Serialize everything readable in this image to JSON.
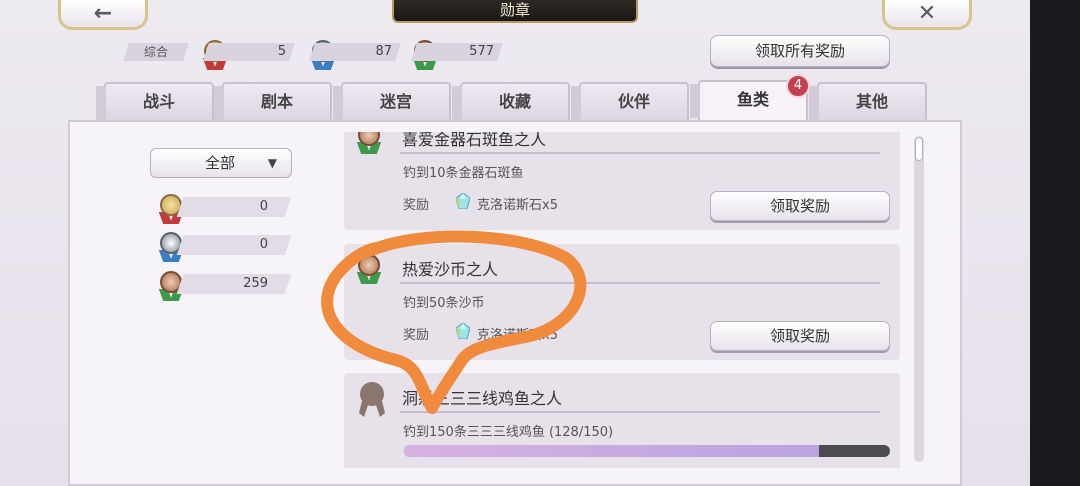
{
  "header": {
    "back_icon": "←",
    "title": "勋章",
    "close_icon": "✕"
  },
  "summary": {
    "label": "综合",
    "gold": "5",
    "silver": "87",
    "bronze": "577"
  },
  "claim_all_label": "领取所有奖励",
  "tabs": [
    {
      "label": "战斗"
    },
    {
      "label": "剧本"
    },
    {
      "label": "迷宫"
    },
    {
      "label": "收藏"
    },
    {
      "label": "伙伴"
    },
    {
      "label": "鱼类",
      "active": true
    },
    {
      "label": "其他"
    }
  ],
  "tab_badge": "4",
  "filter": {
    "selected": "全部",
    "arrow": "▼"
  },
  "counts": {
    "gold": "0",
    "silver": "0",
    "bronze": "259"
  },
  "entries": [
    {
      "title": "喜爱金器石斑鱼之人",
      "desc": "钓到10条金器石斑鱼",
      "reward_label": "奖励",
      "reward": "克洛诺斯石x5",
      "claim_label": "领取奖励"
    },
    {
      "title": "热爱沙币之人",
      "desc": "钓到50条沙币",
      "reward_label": "奖励",
      "reward": "克洛诺斯石x5",
      "claim_label": "领取奖励"
    },
    {
      "title": "洞悉三三三线鸡鱼之人",
      "desc": "钓到150条三三三线鸡鱼 (128/150)",
      "progress": 0.853
    }
  ],
  "colors": {
    "bronze": "#b27a5a",
    "silver": "#9aa3ad",
    "gold": "#d9b45a",
    "accent_orange": "#f08a3c"
  }
}
